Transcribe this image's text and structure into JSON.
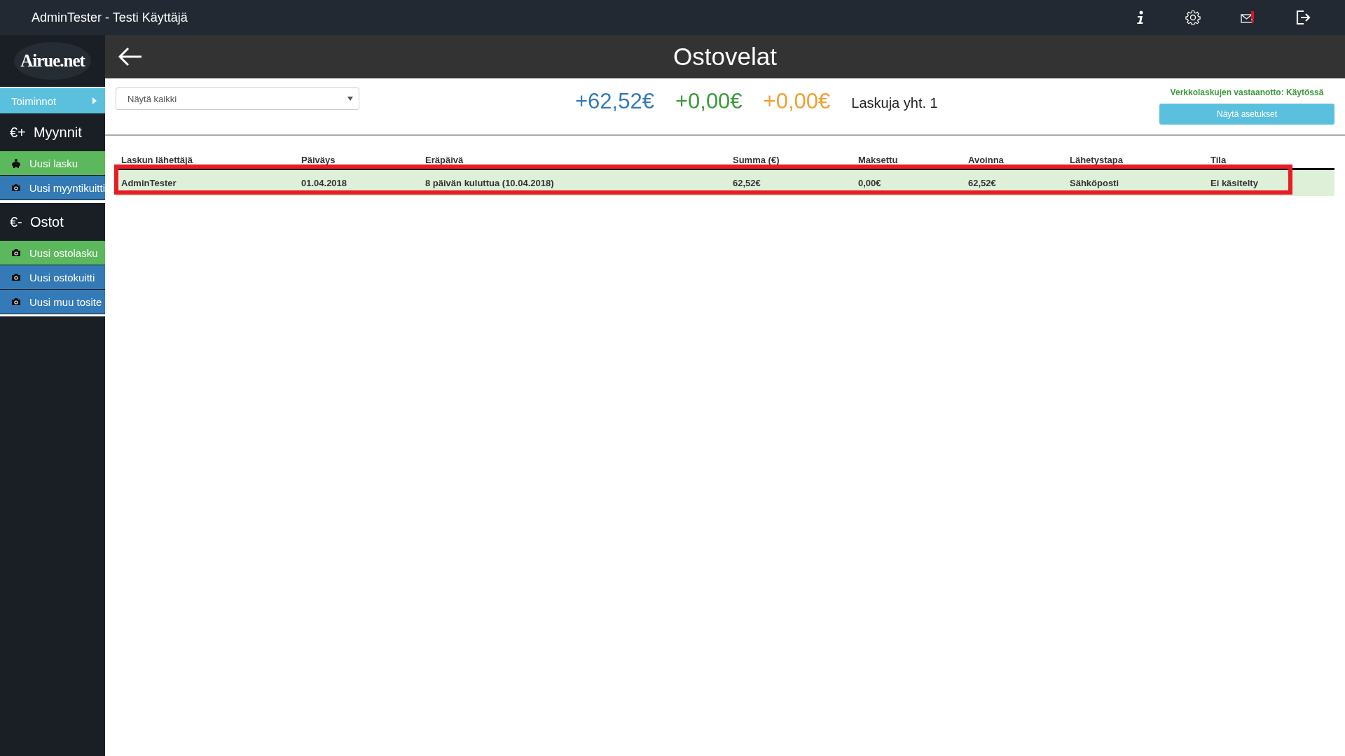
{
  "topbar": {
    "title": "AdminTester - Testi Käyttäjä"
  },
  "sidebar": {
    "logo": "Airue.net",
    "menu_button": "Toiminnot",
    "sections": [
      {
        "prefix": "€+",
        "title": "Myynnit",
        "items": [
          {
            "label": "Uusi lasku",
            "kind": "piggy-bank",
            "color": "#5cb85c"
          },
          {
            "label": "Uusi myyntikuitti",
            "kind": "camera",
            "color": "#337ab7"
          }
        ]
      },
      {
        "prefix": "€-",
        "title": "Ostot",
        "items": [
          {
            "label": "Uusi ostolasku",
            "kind": "camera",
            "color": "#5cb85c"
          },
          {
            "label": "Uusi ostokuitti",
            "kind": "camera",
            "color": "#337ab7"
          },
          {
            "label": "Uusi muu tosite",
            "kind": "camera",
            "color": "#337ab7"
          }
        ]
      }
    ]
  },
  "page": {
    "title": "Ostovelat"
  },
  "filter": {
    "value": "Näytä kaikki"
  },
  "totals": [
    {
      "value": "+62,52€",
      "color": "#337ab7"
    },
    {
      "value": "+0,00€",
      "color": "#3c9a3c"
    },
    {
      "value": "+0,00€",
      "color": "#f0a030"
    }
  ],
  "count": "Laskuja yht. 1",
  "einvoice": {
    "status": "Verkkolaskujen vastaanotto: Käytössä",
    "button": "Näytä asetukset"
  },
  "table": {
    "columns": [
      "Laskun lähettäjä",
      "Päiväys",
      "Eräpäivä",
      "Summa (€)",
      "Maksettu",
      "Avoinna",
      "Lähetystapa",
      "Tila"
    ],
    "rows": [
      {
        "cells": [
          "AdminTester",
          "01.04.2018",
          "8 päivän kuluttua (10.04.2018)",
          "62,52€",
          "0,00€",
          "62,52€",
          "Sähköposti",
          "Ei käsitelty"
        ],
        "selected": true,
        "highlighted": true
      }
    ]
  }
}
